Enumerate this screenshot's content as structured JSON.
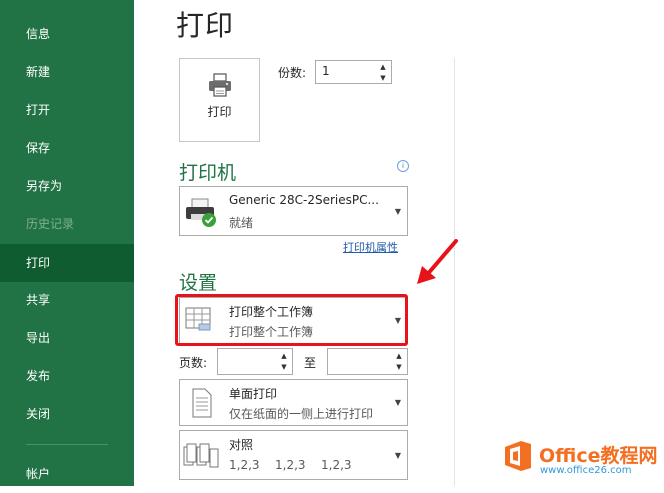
{
  "sidebar": {
    "items": [
      {
        "label": "信息"
      },
      {
        "label": "新建"
      },
      {
        "label": "打开"
      },
      {
        "label": "保存"
      },
      {
        "label": "另存为"
      },
      {
        "label": "历史记录"
      },
      {
        "label": "打印"
      },
      {
        "label": "共享"
      },
      {
        "label": "导出"
      },
      {
        "label": "发布"
      },
      {
        "label": "关闭"
      },
      {
        "label": "帐户"
      }
    ],
    "active_index": 6,
    "disabled_index": 5
  },
  "page": {
    "title": "打印"
  },
  "print_button": {
    "label": "打印",
    "icon": "printer-icon"
  },
  "copies": {
    "label": "份数:",
    "value": "1"
  },
  "printer": {
    "heading": "打印机",
    "name": "Generic 28C-2SeriesPC...",
    "status": "就绪",
    "properties_link": "打印机属性",
    "info_icon": "info-icon"
  },
  "settings": {
    "heading": "设置",
    "scope": {
      "title": "打印整个工作簿",
      "subtitle": "打印整个工作簿"
    },
    "pages": {
      "label": "页数:",
      "from_value": "",
      "to_label": "至",
      "to_value": ""
    },
    "sides": {
      "title": "单面打印",
      "subtitle": "仅在纸面的一侧上进行打印"
    },
    "collate": {
      "title": "对照",
      "subtitle": [
        "1,2,3",
        "1,2,3",
        "1,2,3"
      ]
    }
  },
  "watermark": {
    "title": "Office教程网",
    "url": "www.office26.com"
  },
  "colors": {
    "sidebar": "#217346",
    "active": "#0e5c2f",
    "accent_red": "#e8121b",
    "heading": "#217346"
  }
}
